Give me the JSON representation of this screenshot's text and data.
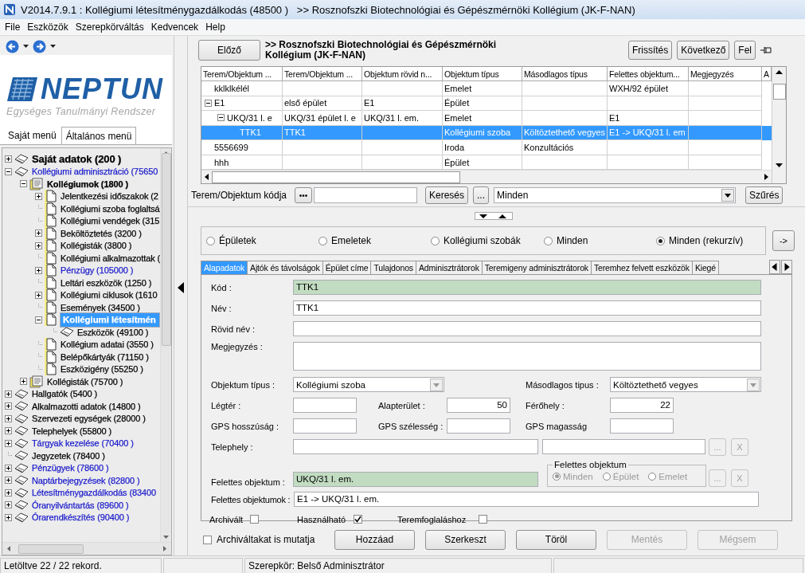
{
  "window": {
    "title": "V2014.7.9.1 : Kollégiumi létesítménygazdálkodás (48500 )   >> Rosznofszki Biotechnológiai és Gépészmérnöki Kollégium (JK-F-NAN)"
  },
  "menu": [
    "File",
    "Eszközök",
    "Szerepkörváltás",
    "Kedvencek",
    "Help"
  ],
  "logo": {
    "name": "NEPTUN",
    "tagline": "Egységes Tanulmányi Rendszer"
  },
  "side_tabs": [
    {
      "label": "Saját menü",
      "selected": false
    },
    {
      "label": "Általános menü",
      "selected": true
    }
  ],
  "tree": {
    "items": [
      {
        "label": "Saját adatok (200 )",
        "kind": "book",
        "bold": true,
        "expanded": false,
        "selected": false
      },
      {
        "label": "Kollégiumi adminisztráció (75650",
        "kind": "book",
        "expanded": true,
        "selected": false,
        "color": "#1c1ccc",
        "children": [
          {
            "label": "Kollégiumok (1800 )",
            "kind": "stack",
            "bold": true,
            "expanded": true,
            "selected": false,
            "children": [
              {
                "label": "Jelentkezési időszakok (2",
                "kind": "page",
                "expanded": false,
                "selected": false
              },
              {
                "label": "Kollégiumi szoba foglaltsá",
                "kind": "page",
                "selected": false
              },
              {
                "label": "Kollégiumi vendégek (315",
                "kind": "page",
                "selected": false
              },
              {
                "label": "Beköltöztetés (3200 )",
                "kind": "page",
                "expanded": false,
                "selected": false
              },
              {
                "label": "Kollégisták (3800 )",
                "kind": "page",
                "expanded": false,
                "selected": false
              },
              {
                "label": "Kollégiumi alkalmazottak (",
                "kind": "page",
                "selected": false
              },
              {
                "label": "Pénzügy (105000 )",
                "kind": "page",
                "expanded": false,
                "selected": false,
                "color": "#1c1ccc"
              },
              {
                "label": "Leltári eszközök (1250 )",
                "kind": "page",
                "selected": false
              },
              {
                "label": "Kollégiumi ciklusok (1610",
                "kind": "page",
                "expanded": false,
                "selected": false
              },
              {
                "label": "Események (34500 )",
                "kind": "page",
                "selected": false
              },
              {
                "label": "Kollégiumi létesítmén",
                "kind": "page",
                "bold": true,
                "expanded": true,
                "selected": true,
                "children": [
                  {
                    "label": "Eszközök (49100 )",
                    "kind": "book",
                    "selected": false
                  }
                ]
              },
              {
                "label": "Kollégium adatai (3550 )",
                "kind": "page",
                "selected": false
              },
              {
                "label": "Belépőkártyák (71150 )",
                "kind": "page",
                "selected": false
              },
              {
                "label": "Eszközigény (55250 )",
                "kind": "page",
                "selected": false
              }
            ]
          },
          {
            "label": "Kollégisták (75700 )",
            "kind": "stack",
            "expanded": false,
            "selected": false
          }
        ]
      },
      {
        "label": "Hallgatók (5400 )",
        "kind": "book",
        "expanded": false,
        "selected": false
      },
      {
        "label": "Alkalmazotti adatok (14800 )",
        "kind": "book",
        "expanded": false,
        "selected": false
      },
      {
        "label": "Szervezeti egységek (28000 )",
        "kind": "book",
        "expanded": false,
        "selected": false
      },
      {
        "label": "Telephelyek (55800 )",
        "kind": "book",
        "expanded": false,
        "selected": false
      },
      {
        "label": "Tárgyak kezelése (70400 )",
        "kind": "book",
        "expanded": false,
        "selected": false,
        "color": "#1c1ccc"
      },
      {
        "label": "Jegyzetek (78400 )",
        "kind": "book",
        "selected": false
      },
      {
        "label": "Pénzügyek (78600 )",
        "kind": "book",
        "expanded": false,
        "selected": false,
        "color": "#1c1ccc"
      },
      {
        "label": "Naptárbejegyzések (82800 )",
        "kind": "book",
        "expanded": false,
        "selected": false,
        "color": "#1c1ccc"
      },
      {
        "label": "Létesítménygazdálkodás (83400",
        "kind": "book",
        "expanded": false,
        "selected": false,
        "color": "#1c1ccc"
      },
      {
        "label": "Óranyilvántartás (89600 )",
        "kind": "book",
        "expanded": false,
        "selected": false,
        "color": "#1c1ccc"
      },
      {
        "label": "Órarendkészítés (90400 )",
        "kind": "book",
        "expanded": false,
        "selected": false,
        "color": "#1c1ccc"
      }
    ]
  },
  "header": {
    "prev": "Előző",
    "title": ">> Rosznofszki Biotechnológiai és Gépészmérnöki Kollégium (JK-F-NAN)",
    "buttons": [
      "Frissítés",
      "Következő",
      "Fel"
    ]
  },
  "grid": {
    "columns": [
      "Terem/Objektum ...",
      "Terem/Objektum ...",
      "Objektum rövid n...",
      "Objektum típus",
      "Másodlagos típus",
      "Felettes objektum...",
      "Megjegyzés",
      "A"
    ],
    "rows": [
      {
        "cells": [
          "kklklkélél",
          null,
          null,
          "Emelet",
          null,
          "WXH/92 épület",
          null
        ],
        "selected": false
      },
      {
        "cells": [
          "E1",
          "első épület",
          "E1",
          "Épület",
          null,
          null,
          null
        ],
        "selected": false,
        "expanded": true,
        "children": [
          {
            "cells": [
              "UKQ/31 l. e",
              "UKQ/31 épület l. e",
              "UKQ/31 l. em.",
              "Emelet",
              null,
              "E1",
              null
            ],
            "selected": false,
            "expanded": true,
            "children": [
              {
                "cells": [
                  "TTK1",
                  "TTK1",
                  null,
                  "Kollégiumi szoba",
                  "Költöztethető vegyes",
                  "E1 -> UKQ/31 l. em",
                  null
                ],
                "selected": true
              }
            ]
          }
        ]
      },
      {
        "cells": [
          "5556699",
          null,
          null,
          "Iroda",
          "Konzultációs",
          null,
          null
        ],
        "selected": false
      },
      {
        "cells": [
          "hhh",
          null,
          null,
          "Épület",
          null,
          null,
          null
        ],
        "selected": false
      }
    ]
  },
  "search": {
    "label": "Terem/Objektum kódja",
    "dots_button": "•••",
    "search_button": "Keresés",
    "more_button": "...",
    "filter": "Minden",
    "filter_button": "Szűrés"
  },
  "scope": {
    "options": [
      {
        "label": "Épületek",
        "selected": false
      },
      {
        "label": "Emeletek",
        "selected": false
      },
      {
        "label": "Kollégiumi szobák",
        "selected": false
      },
      {
        "label": "Minden",
        "selected": false
      },
      {
        "label": "Minden (rekurzív)",
        "selected": true
      }
    ],
    "go_button": "->"
  },
  "tabs": [
    {
      "label": "Alapadatok",
      "selected": true
    },
    {
      "label": "Ajtók és távolságok",
      "selected": false
    },
    {
      "label": "Épület címe",
      "selected": false
    },
    {
      "label": "Tulajdonos",
      "selected": false
    },
    {
      "label": "Adminisztrátorok",
      "selected": false
    },
    {
      "label": "Teremigeny adminisztrátorok",
      "selected": false
    },
    {
      "label": "Teremhez felvett eszközök",
      "selected": false
    },
    {
      "label": "Kiegé",
      "selected": false
    }
  ],
  "form": {
    "kod": {
      "label": "Kód :",
      "value": "TTK1",
      "readonly": true
    },
    "nev": {
      "label": "Név :",
      "value": "TTK1"
    },
    "rovid_nev": {
      "label": "Rövid név :"
    },
    "megjegyzes": {
      "label": "Megjegyzés :"
    },
    "objektum_tipus": {
      "label": "Objektum típus :",
      "value": "Kollégiumi szoba"
    },
    "masodlagos_tipus": {
      "label": "Másodlagos tipus :",
      "value": "Költöztethető vegyes"
    },
    "legter": {
      "label": "Légtér :"
    },
    "alapterulet": {
      "label": "Alapterület :",
      "value": "50"
    },
    "ferohely": {
      "label": "Férőhely :",
      "value": "22"
    },
    "gps_hosszusag": {
      "label": "GPS hosszúság :"
    },
    "gps_szelesseg": {
      "label": "GPS szélesség :"
    },
    "gps_magassag": {
      "label": "GPS magasság"
    },
    "telephely": {
      "label": "Telephely :",
      "buttons": [
        {
          "label": "...",
          "disabled": true
        },
        {
          "label": "X",
          "disabled": true
        }
      ]
    },
    "felettes_objektum": {
      "label": "Felettes objektum :",
      "value": "UKQ/31 l. em.",
      "readonly": true,
      "group": {
        "title": "Felettes objektum",
        "disabled": true,
        "options": [
          {
            "label": "Minden",
            "selected": true
          },
          {
            "label": "Épület",
            "selected": false
          },
          {
            "label": "Emelet",
            "selected": false
          }
        ]
      },
      "buttons": [
        {
          "label": "...",
          "disabled": true
        },
        {
          "label": "X",
          "disabled": true
        }
      ]
    },
    "felettes_objektumok": {
      "label": "Felettes objektumok :",
      "value": "E1 -> UKQ/31 l. em."
    },
    "checks": [
      {
        "label": "Archivált",
        "checked": false
      },
      {
        "label": "Használható",
        "checked": true
      },
      {
        "label": "Teremfoglaláshoz",
        "checked": false
      }
    ]
  },
  "footer": {
    "archived": {
      "label": "Archiváltakat is mutatja",
      "checked": false
    },
    "buttons": [
      {
        "label": "Hozzáad",
        "disabled": false
      },
      {
        "label": "Szerkeszt",
        "disabled": false
      },
      {
        "label": "Töröl",
        "disabled": false
      },
      {
        "label": "Mentés",
        "disabled": true
      },
      {
        "label": "Mégsem",
        "disabled": true
      }
    ]
  },
  "status_bar": {
    "records": "Letöltve 22 / 22 rekord.",
    "role": "Szerepkör: Belső Adminisztrátor"
  }
}
